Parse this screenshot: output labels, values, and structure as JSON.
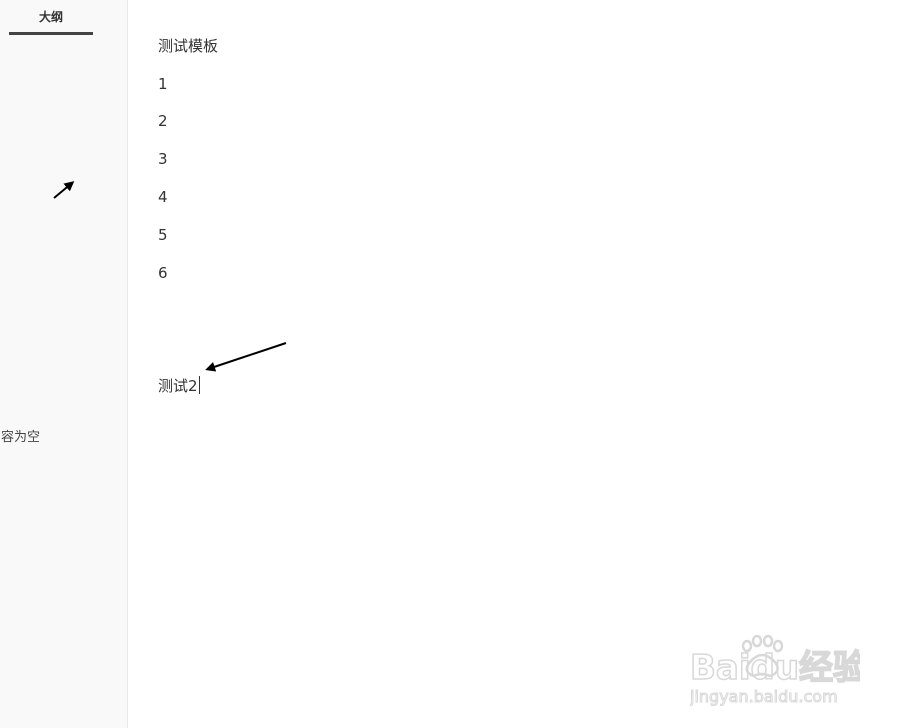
{
  "sidebar": {
    "tab_label": "大纲",
    "empty_text": "内容为空"
  },
  "editor": {
    "lines": [
      "测试模板",
      "1",
      "2",
      "3",
      "4",
      "5",
      "6"
    ],
    "current_line": "测试2"
  },
  "watermark": {
    "brand": "Baidu经验",
    "url": "jingyan.baidu.com"
  },
  "colors": {
    "sidebar_bg": "#f9f9f9",
    "text": "#333333",
    "tab_underline": "#444444"
  }
}
